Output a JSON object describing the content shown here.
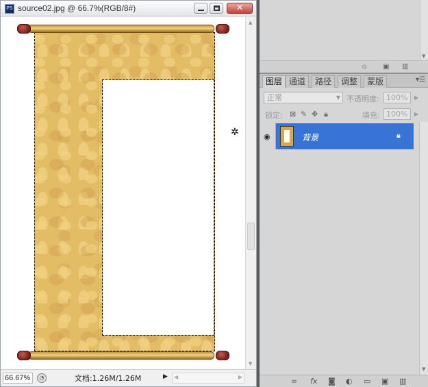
{
  "document": {
    "title": "source02.jpg @ 66.7%(RGB/8#)",
    "app_icon": "PS",
    "close_glyph": "✕",
    "zoom": "66.67%",
    "doc_info": "文档:1.26M/1.26M"
  },
  "layers_panel": {
    "tabs": [
      {
        "label": "图层"
      },
      {
        "label": "通道"
      },
      {
        "label": "路径"
      },
      {
        "label": "调整"
      },
      {
        "label": "蒙版"
      }
    ],
    "blend_mode": "正常",
    "opacity_label": "不透明度:",
    "opacity_value": "100%",
    "lock_label": "锁定:",
    "fill_label": "填充:",
    "fill_value": "100%",
    "layers": [
      {
        "name": "背景"
      }
    ]
  },
  "colors": {
    "selected_layer": "#3873d6",
    "mount": "#e3bc66",
    "rod_knob": "#7a1f18"
  }
}
